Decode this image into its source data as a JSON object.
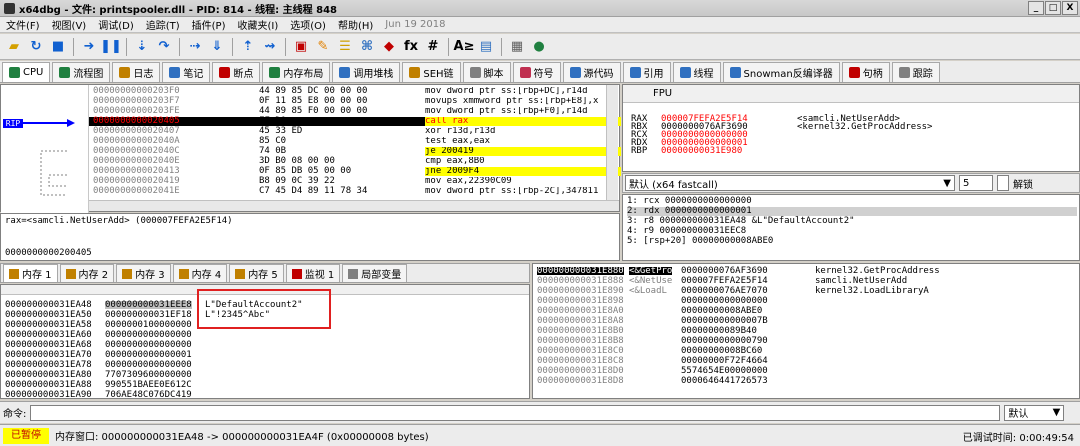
{
  "window": {
    "title": "x64dbg - 文件: printspooler.dll - PID: 814 - 线程: 主线程 848",
    "btn_min": "_",
    "btn_max": "□",
    "btn_close": "X"
  },
  "menu": [
    "文件(F)",
    "视图(V)",
    "调试(D)",
    "追踪(T)",
    "插件(P)",
    "收藏夹(I)",
    "选项(O)",
    "帮助(H)"
  ],
  "menu_date": "Jun 19 2018",
  "toolbar_text": {
    "fx": "fx",
    "hash": "#",
    "az": "A≥"
  },
  "tabs": [
    "CPU",
    "流程图",
    "日志",
    "笔记",
    "断点",
    "内存布局",
    "调用堆栈",
    "SEH链",
    "脚本",
    "符号",
    "源代码",
    "引用",
    "线程",
    "Snowman反编译器",
    "句柄",
    "跟踪"
  ],
  "disasm": [
    {
      "addr": "00000000000203F0",
      "bytes": "44 89 85 DC 00 00 00",
      "dis": "mov dword ptr ss:[rbp+DC],r14d"
    },
    {
      "addr": "00000000000203F7",
      "bytes": "0F 11 85 E8 00 00 00",
      "dis": "movups xmmword ptr ss:[rbp+E8],x"
    },
    {
      "addr": "00000000000203FE",
      "bytes": "44 89 85 F0 00 00 00",
      "dis": "mov dword ptr ss:[rbp+F0],r14d"
    },
    {
      "addr": "0000000000020405",
      "bytes": "FF D0",
      "dis": "call rax",
      "current": true
    },
    {
      "addr": "0000000000020407",
      "bytes": "45 33 ED",
      "dis": "xor r13d,r13d"
    },
    {
      "addr": "000000000002040A",
      "bytes": "85 C0",
      "dis": "test eax,eax"
    },
    {
      "addr": "000000000002040C",
      "bytes": "74 0B",
      "dis": "je 200419"
    },
    {
      "addr": "000000000002040E",
      "bytes": "3D B0 08 00 00",
      "dis": "cmp eax,8B0"
    },
    {
      "addr": "0000000000020413",
      "bytes": "0F 85 DB 05 00 00",
      "dis": "jne 2009F4"
    },
    {
      "addr": "0000000000020419",
      "bytes": "B8 09 0C 39 22",
      "dis": "mov eax,22390C09"
    },
    {
      "addr": "000000000002041E",
      "bytes": "C7 45 D4 89 11 78 34",
      "dis": "mov dword ptr ss:[rbp-2C],347811"
    }
  ],
  "rip_label": "RIP",
  "info": {
    "line1": "rax=<samcli.NetUserAdd> (000007FEFA2E5F14)",
    "line2": "0000000000200405"
  },
  "fpu": {
    "header": "FPU",
    "registers": [
      {
        "name": "RAX",
        "value": "000007FEFA2E5F14",
        "comment": "<samcli.NetUserAdd>"
      },
      {
        "name": "RBX",
        "value": "0000000076AF3690",
        "comment": "<kernel32.GetProcAddress>"
      },
      {
        "name": "RCX",
        "value": "0000000000000000",
        "comment": ""
      },
      {
        "name": "RDX",
        "value": "0000000000000001",
        "comment": ""
      },
      {
        "name": "RBP",
        "value": "00000000031E980",
        "comment": ""
      }
    ]
  },
  "callconv": {
    "label": "默认 (x64 fastcall)",
    "count": "5",
    "lock": "解锁"
  },
  "args": [
    "1: rcx 0000000000000000",
    "2: rdx 0000000000000001",
    "3: r8 000000000031EA48 &L\"DefaultAccount2\"",
    "4: r9 000000000031EEC8",
    "5: [rsp+20] 00000000008ABE0"
  ],
  "memtabs": [
    "内存 1",
    "内存 2",
    "内存 3",
    "内存 4",
    "内存 5",
    "监视 1",
    "局部变量"
  ],
  "dump": [
    {
      "addr": "000000000031EA48",
      "val": "000000000031EEE8",
      "text": "L\"DefaultAccount2\""
    },
    {
      "addr": "000000000031EA50",
      "val": "000000000031EF18",
      "text": "L\"!2345^Abc\""
    },
    {
      "addr": "000000000031EA58",
      "val": "0000000100000000",
      "text": ""
    },
    {
      "addr": "000000000031EA60",
      "val": "0000000000000000",
      "text": ""
    },
    {
      "addr": "000000000031EA68",
      "val": "0000000000000000",
      "text": ""
    },
    {
      "addr": "000000000031EA70",
      "val": "0000000000000001",
      "text": ""
    },
    {
      "addr": "000000000031EA78",
      "val": "0000000000000000",
      "text": ""
    },
    {
      "addr": "000000000031EA80",
      "val": "7707309600000000",
      "text": ""
    },
    {
      "addr": "000000000031EA88",
      "val": "990551BAEE0E612C",
      "text": ""
    },
    {
      "addr": "000000000031EA90",
      "val": "706AE48C076DC419",
      "text": ""
    }
  ],
  "stack": [
    {
      "addr": "000000000031E880",
      "val": "0000000076AF3690",
      "cmt": "kernel32.GetProcAddress",
      "tag": "<&GetPro"
    },
    {
      "addr": "000000000031E888",
      "val": "000007FEFA2E5F14",
      "cmt": "samcli.NetUserAdd",
      "tag": "<&NetUse"
    },
    {
      "addr": "000000000031E890",
      "val": "0000000076AE7070",
      "cmt": "kernel32.LoadLibraryA",
      "tag": "<&LoadL"
    },
    {
      "addr": "000000000031E898",
      "val": "0000000000000000",
      "cmt": "",
      "tag": ""
    },
    {
      "addr": "000000000031E8A0",
      "val": "00000000008ABE0",
      "cmt": "",
      "tag": ""
    },
    {
      "addr": "000000000031E8A8",
      "val": "000000000000007B",
      "cmt": "",
      "tag": ""
    },
    {
      "addr": "000000000031E8B0",
      "val": "00000000089B40",
      "cmt": "",
      "tag": ""
    },
    {
      "addr": "000000000031E8B8",
      "val": "0000000000000790",
      "cmt": "",
      "tag": ""
    },
    {
      "addr": "000000000031E8C0",
      "val": "00000000008BC60",
      "cmt": "",
      "tag": ""
    },
    {
      "addr": "000000000031E8C8",
      "val": "00000000F72F4664",
      "cmt": "",
      "tag": ""
    },
    {
      "addr": "000000000031E8D0",
      "val": "5574654E00000000",
      "cmt": "",
      "tag": ""
    },
    {
      "addr": "000000000031E8D8",
      "val": "0000646441726573",
      "cmt": "",
      "tag": ""
    }
  ],
  "cmd": {
    "label": "命令:",
    "mode": "默认"
  },
  "status": {
    "paused": "已暂停",
    "text": "内存窗口: 000000000031EA48 -> 000000000031EA4F (0x00000008 bytes)",
    "time": "已调试时间: 0:00:49:54"
  },
  "colors": {
    "accent": "#0000ff",
    "paused_bg": "#ffff00",
    "highlight": "#000000",
    "callbox": "#e02020"
  }
}
